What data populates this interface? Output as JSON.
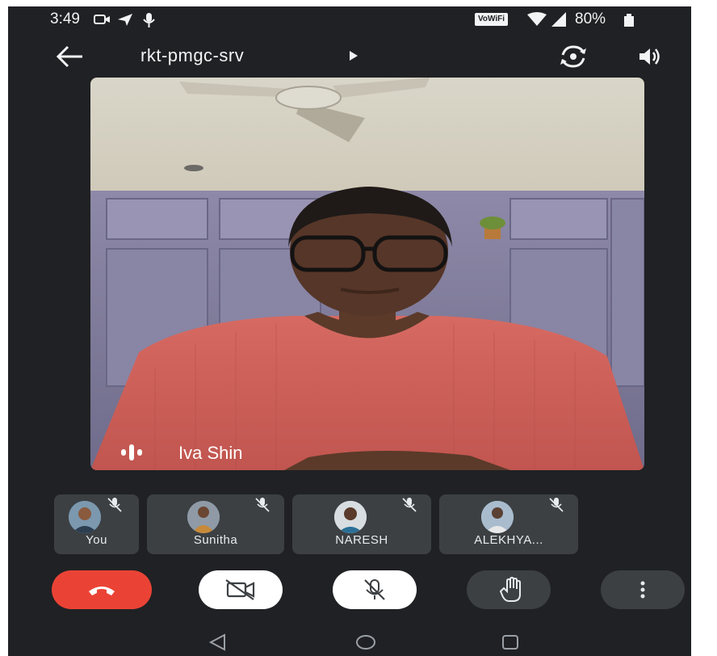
{
  "status_bar": {
    "time": "3:49",
    "wifi_badge": "VoWiFi",
    "battery": "80%"
  },
  "header": {
    "back_icon": "back-arrow-icon",
    "title": "rkt-pmgc-srv",
    "title_arrow_icon": "play-arrow-icon",
    "switch_camera_icon": "switch-camera-icon",
    "audio_output_icon": "speaker-icon"
  },
  "main_video": {
    "speaker_name": "Iva Shin",
    "speaking_icon": "audio-level-icon"
  },
  "participants": [
    {
      "name": "You",
      "muted": true
    },
    {
      "name": "Sunitha",
      "muted": true
    },
    {
      "name": "NARESH",
      "muted": true
    },
    {
      "name": "ALEKHYA...",
      "muted": true
    }
  ],
  "controls": {
    "end_call_icon": "end-call-icon",
    "camera_icon": "camera-off-icon",
    "mic_icon": "mic-off-icon",
    "raise_hand_icon": "hand-icon",
    "more_icon": "more-vert-icon",
    "end_call_color": "#ea4335"
  },
  "nav": {
    "back": "triangle-back-icon",
    "home": "circle-home-icon",
    "recents": "square-recents-icon"
  }
}
